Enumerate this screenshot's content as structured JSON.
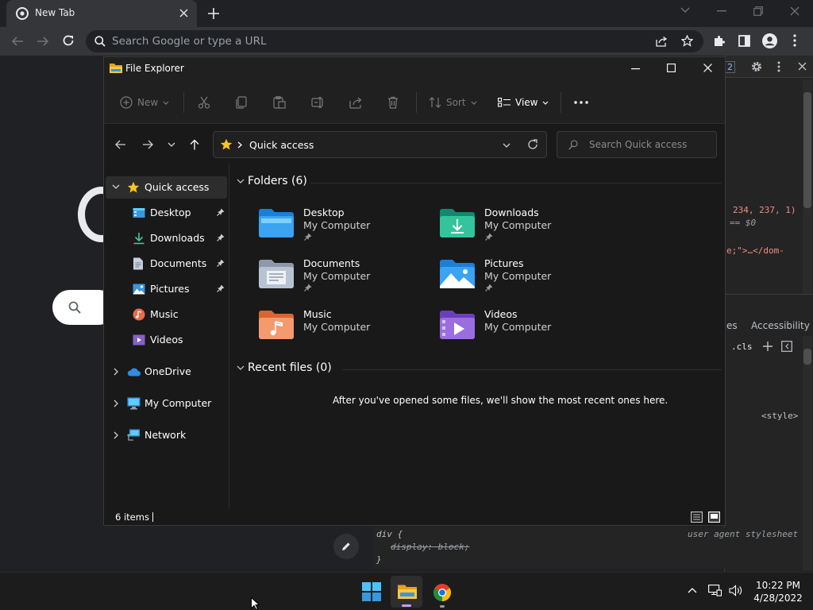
{
  "browser": {
    "tab_title": "New Tab",
    "omnibox_placeholder": "Search Google or type a URL"
  },
  "devtools": {
    "code_line1": "234, 237, 1)",
    "code_line2": "== $0",
    "code_line3": "e;\">…</dom-",
    "tab_partial": "es",
    "tab_accessibility": "Accessibility",
    "cls": ".cls",
    "style_tag": "<style>",
    "rule_selector": "div {",
    "rule_source": "user agent stylesheet",
    "rule_prop": "display: block;",
    "rule_close": "}",
    "badge": "2"
  },
  "explorer": {
    "title": "File Explorer",
    "commands": {
      "new": "New",
      "sort": "Sort",
      "view": "View"
    },
    "address": "Quick access",
    "search_placeholder": "Search Quick access",
    "nav": {
      "quick_access": "Quick access",
      "items": [
        "Desktop",
        "Downloads",
        "Documents",
        "Pictures",
        "Music",
        "Videos"
      ],
      "onedrive": "OneDrive",
      "my_computer": "My Computer",
      "network": "Network"
    },
    "folders_header": "Folders (6)",
    "folders": [
      {
        "name": "Desktop",
        "location": "My Computer"
      },
      {
        "name": "Downloads",
        "location": "My Computer"
      },
      {
        "name": "Documents",
        "location": "My Computer"
      },
      {
        "name": "Pictures",
        "location": "My Computer"
      },
      {
        "name": "Music",
        "location": "My Computer"
      },
      {
        "name": "Videos",
        "location": "My Computer"
      }
    ],
    "recent_header": "Recent files (0)",
    "recent_empty": "After you've opened some files, we'll show the most recent ones here.",
    "status": "6 items"
  },
  "taskbar": {
    "time": "10:22 PM",
    "date": "4/28/2022"
  }
}
